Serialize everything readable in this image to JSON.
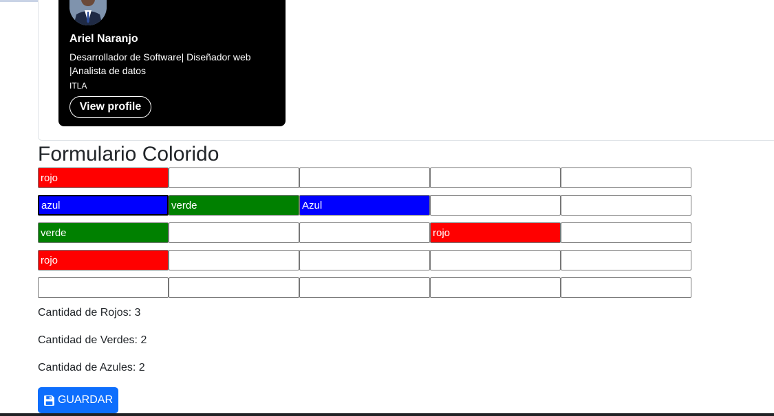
{
  "profile": {
    "name": "Ariel Naranjo",
    "headline": "Desarrollador de Software| Diseñador web |Analista de datos",
    "school": "ITLA",
    "view_profile_label": "View profile"
  },
  "form": {
    "title": "Formulario Colorido",
    "rows": [
      [
        "rojo",
        "",
        "",
        "",
        ""
      ],
      [
        "azul",
        "verde",
        "Azul",
        "",
        ""
      ],
      [
        "verde",
        "",
        "",
        "rojo",
        ""
      ],
      [
        "rojo",
        "",
        "",
        "",
        ""
      ],
      [
        "",
        "",
        "",
        "",
        ""
      ]
    ],
    "colors": {
      "rojo": "#ff0000",
      "verde": "#008000",
      "azul": "#0000ff"
    },
    "focused_cell": "row 2, column 1"
  },
  "counts": {
    "rojos": "Cantidad de Rojos: 3",
    "verdes": "Cantidad de Verdes: 2",
    "azules": "Cantidad de Azules: 2"
  },
  "save_button": {
    "label": "GUARDAR",
    "icon": "floppy-disk-icon",
    "color": "#0d6efd"
  }
}
